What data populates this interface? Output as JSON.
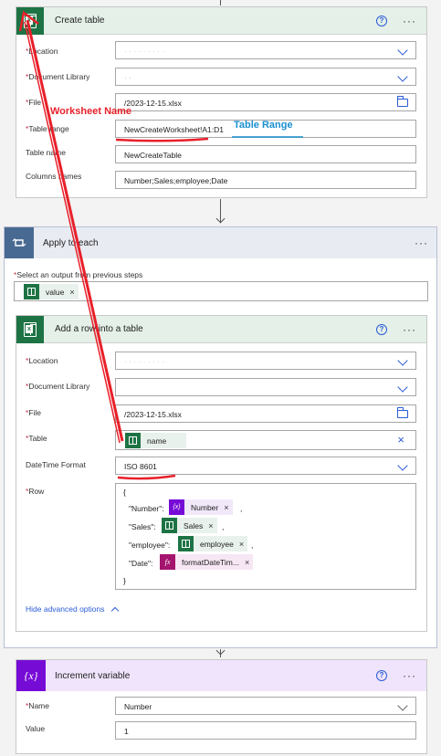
{
  "create_table": {
    "title": "Create table",
    "help": "?",
    "more": "···",
    "location_label": "Location",
    "document_library_label": "Document Library",
    "file_label": "File",
    "file_value": "/2023-12-15.xlsx",
    "table_range_label": "Table range",
    "table_range_value": "NewCreateWorksheet!A1:D1",
    "table_name_label": "Table name",
    "table_name_value": "NewCreateTable",
    "columns_names_label": "Columns names",
    "columns_names_value": "Number;Sales;employee;Date"
  },
  "annotations": {
    "worksheet_name": "Worksheet Name",
    "table_range": "Table Range",
    "annotation_red": "#e8202a",
    "annotation_blue": "#1a8fd0"
  },
  "apply_to_each": {
    "title": "Apply to each",
    "more": "···",
    "select_label": "Select an output from previous steps",
    "token": "value"
  },
  "add_row": {
    "title": "Add a row into a table",
    "help": "?",
    "more": "···",
    "location_label": "Location",
    "document_library_label": "Document Library",
    "file_label": "File",
    "file_value": "/2023-12-15.xlsx",
    "table_label": "Table",
    "table_token": "name",
    "datetime_label": "DateTime Format",
    "datetime_value": "ISO 8601",
    "row_label": "Row",
    "row": {
      "open": "{",
      "number_key": "\"Number\":",
      "number_token": "Number",
      "sales_key": "\"Sales\":",
      "sales_token": "Sales",
      "employee_key": "\"employee\":",
      "employee_token": "employee",
      "date_key": "\"Date\":",
      "date_token": "formatDateTim...",
      "comma": ",",
      "close": "}"
    },
    "hide_advanced": "Hide advanced options"
  },
  "increment": {
    "title": "Increment variable",
    "help": "?",
    "more": "···",
    "name_label": "Name",
    "name_value": "Number",
    "value_label": "Value",
    "value_value": "1"
  },
  "colors": {
    "excel_green": "#1d7344",
    "excel_header": "#e4f0e8",
    "loop_header": "#e9ebf3",
    "loop_blue": "#486991",
    "variable_purple": "#770bd6",
    "variable_header": "#efe4fb",
    "link_blue": "#2a5bd7"
  },
  "icons": {
    "excel": "excel-icon",
    "loop": "loop-icon",
    "variable": "variable-icon",
    "help": "help-icon",
    "more": "more-icon",
    "chevron": "chevron-down-icon",
    "folder": "folder-icon",
    "close": "close-icon",
    "function": "function-icon",
    "chevron_up": "chevron-up-icon"
  }
}
